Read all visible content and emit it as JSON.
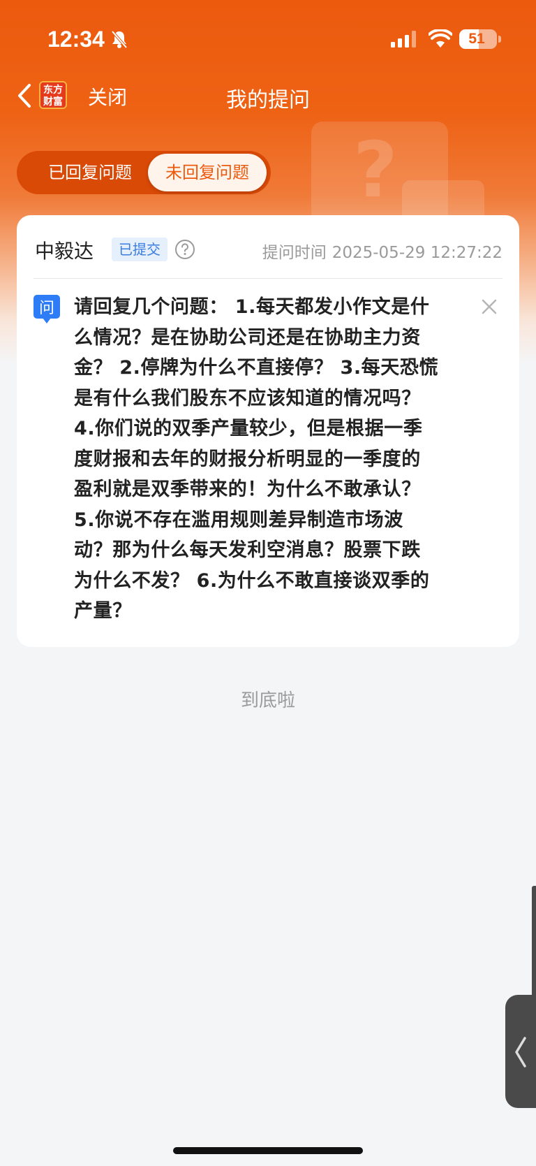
{
  "status_bar": {
    "time": "12:34",
    "battery": "51",
    "battery_level_percent": 51
  },
  "nav": {
    "logo_text": [
      "东方",
      "财富"
    ],
    "close_label": "关闭",
    "title": "我的提问"
  },
  "tabs": {
    "items": [
      {
        "label": "已回复问题",
        "selected": false
      },
      {
        "label": "未回复问题",
        "selected": true
      }
    ]
  },
  "question_card": {
    "company": "中毅达",
    "status": "已提交",
    "time_label": "提问时间",
    "time_value": "2025-05-29 12:27:22",
    "question_badge": "问",
    "lines": [
      "请回复几个问题： 1.每天都发小作文是什",
      "么情况？是在协助公司还是在协助主力资",
      "金？ 2.停牌为什么不直接停？ 3.每天恐慌",
      "是有什么我们股东不应该知道的情况吗？",
      "4.你们说的双季产量较少，但是根据一季",
      "度财报和去年的财报分析明显的一季度的",
      "盈利就是双季带来的！为什么不敢承认？",
      "5.你说不存在滥用规则差异制造市场波",
      "动？那为什么每天发利空消息？股票下跌",
      "为什么不发？ 6.为什么不敢直接谈双季的",
      "产量？"
    ]
  },
  "footer": {
    "end_tip": "到底啦"
  },
  "colors": {
    "brand_orange": "#ec5a0e",
    "badge_blue": "#3a7de0"
  }
}
